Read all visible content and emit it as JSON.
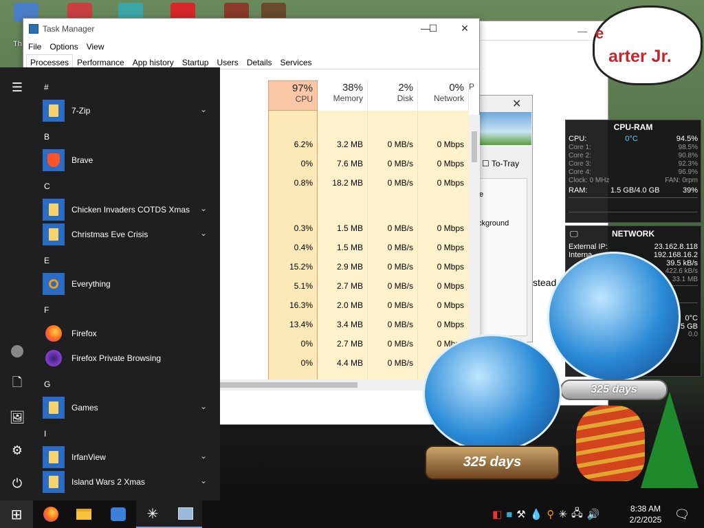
{
  "desktop": {
    "label_partial": "Th"
  },
  "bg_window": {
    "banner_text": "arter Jr.",
    "banner_text_top": "e",
    "totray": "To-Tray",
    "bg_text": "ckground",
    "e_text": "e",
    "stead_text": "stead"
  },
  "task_manager": {
    "title": "Task Manager",
    "menu": [
      "File",
      "Options",
      "View"
    ],
    "tabs": [
      "Processes",
      "Performance",
      "App history",
      "Startup",
      "Users",
      "Details",
      "Services"
    ],
    "active_tab": "Processes",
    "columns": [
      {
        "pct": "97%",
        "label": "CPU"
      },
      {
        "pct": "38%",
        "label": "Memory"
      },
      {
        "pct": "2%",
        "label": "Disk"
      },
      {
        "pct": "0%",
        "label": "Network"
      },
      {
        "pct": "",
        "label": "P"
      }
    ],
    "rows": [
      {
        "cpu": "",
        "mem": "",
        "disk": "",
        "net": ""
      },
      {
        "cpu": "6.2%",
        "mem": "3.2 MB",
        "disk": "0 MB/s",
        "net": "0 Mbps"
      },
      {
        "cpu": "0%",
        "mem": "7.6 MB",
        "disk": "0 MB/s",
        "net": "0 Mbps"
      },
      {
        "cpu": "0.8%",
        "mem": "18.2 MB",
        "disk": "0 MB/s",
        "net": "0 Mbps"
      },
      {
        "cpu": "",
        "mem": "",
        "disk": "",
        "net": ""
      },
      {
        "cpu": "0.3%",
        "mem": "1.5 MB",
        "disk": "0 MB/s",
        "net": "0 Mbps"
      },
      {
        "cpu": "0.4%",
        "mem": "1.5 MB",
        "disk": "0 MB/s",
        "net": "0 Mbps"
      },
      {
        "cpu": "15.2%",
        "mem": "2.9 MB",
        "disk": "0 MB/s",
        "net": "0 Mbps"
      },
      {
        "cpu": "5.1%",
        "mem": "2.7 MB",
        "disk": "0 MB/s",
        "net": "0 Mbps"
      },
      {
        "cpu": "16.3%",
        "mem": "2.0 MB",
        "disk": "0 MB/s",
        "net": "0 Mbps"
      },
      {
        "cpu": "13.4%",
        "mem": "3.4 MB",
        "disk": "0 MB/s",
        "net": "0 Mbps"
      },
      {
        "cpu": "0%",
        "mem": "2.7 MB",
        "disk": "0 MB/s",
        "net": "0 Mbps"
      },
      {
        "cpu": "0%",
        "mem": "4.4 MB",
        "disk": "0 MB/s",
        "net": "0 Mbps"
      }
    ]
  },
  "start_menu": {
    "letters": {
      "hash": "#",
      "b": "B",
      "c": "C",
      "e": "E",
      "f": "F",
      "g": "G",
      "i": "I"
    },
    "apps": {
      "zip": "7-Zip",
      "brave": "Brave",
      "chicken": "Chicken Invaders COTDS Xmas",
      "christmas": "Christmas Eve Crisis",
      "everything": "Everything",
      "firefox": "Firefox",
      "firefox_private": "Firefox Private Browsing",
      "games": "Games",
      "irfanview": "IrfanView",
      "island": "Island Wars 2 Xmas"
    }
  },
  "cpu_widget": {
    "title": "CPU-RAM",
    "cpu_label": "CPU:",
    "temp": "0°C",
    "cpu_value": "94.5%",
    "cores": [
      {
        "label": "Core 1:",
        "value": "98.5%"
      },
      {
        "label": "Core 2:",
        "value": "90.8%"
      },
      {
        "label": "Core 3:",
        "value": "92.3%"
      },
      {
        "label": "Core 4:",
        "value": "96.9%"
      }
    ],
    "clock": "Clock: 0 MHz",
    "fan": "FAN: 0rpm",
    "ram_label": "RAM:",
    "ram_value": "1.5 GB/4.0 GB",
    "ram_pct": "39%"
  },
  "net_widget": {
    "title": "NETWORK",
    "external_label": "External IP:",
    "external_value": "23.162.8.118",
    "internal_label": "Interna",
    "internal_value": "192.168.16.2",
    "down": "39.5 kB/s",
    "up": "422.6 kB/s",
    "total": "33.1 MB",
    "temp2": "0°C",
    "size2": "9.5 GB",
    "small": "0.0"
  },
  "globes": {
    "big_days": "325 days",
    "right_days": "325 days"
  },
  "taskbar": {
    "time": "8:38 AM",
    "date": "2/2/2025"
  }
}
